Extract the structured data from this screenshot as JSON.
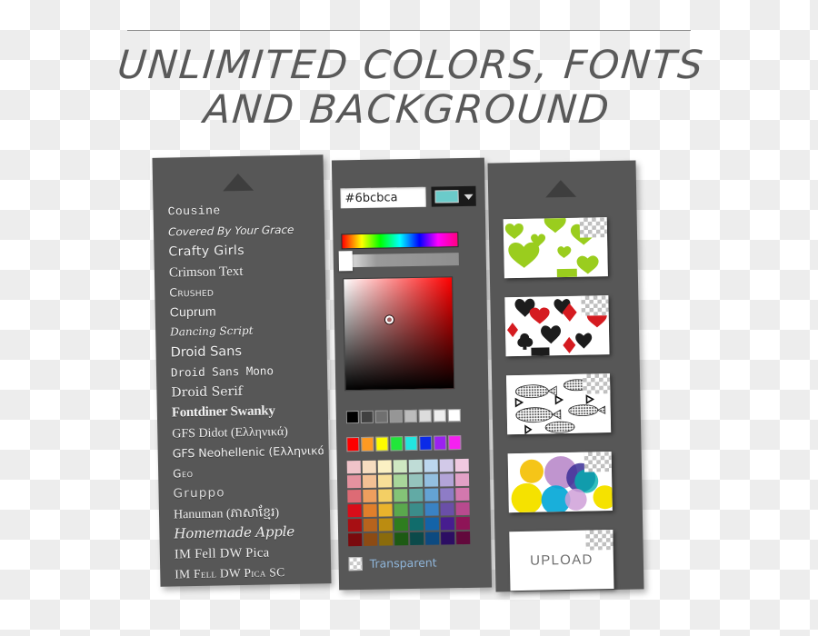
{
  "headline": {
    "line1": "UNLIMITED COLORS, FONTS",
    "line2": "AND BACKGROUND"
  },
  "fonts_panel": {
    "scroll_up_icon": "triangle-up-icon",
    "items": [
      {
        "label": "Cousine",
        "style": "f-mono"
      },
      {
        "label": "Covered By Your Grace",
        "style": "f-hand"
      },
      {
        "label": "Crafty Girls",
        "style": "f-round"
      },
      {
        "label": "Crimson Text",
        "style": "f-serif"
      },
      {
        "label": "Crushed",
        "style": "f-smallcap"
      },
      {
        "label": "Cuprum",
        "style": "f-cond"
      },
      {
        "label": "Dancing Script",
        "style": "f-script"
      },
      {
        "label": "Droid Sans",
        "style": "f-sans"
      },
      {
        "label": "Droid Sans Mono",
        "style": "f-sansmono"
      },
      {
        "label": "Droid Serif",
        "style": "f-dserif"
      },
      {
        "label": "Fontdiner Swanky",
        "style": "f-swanky"
      },
      {
        "label": "GFS Didot (Ελληνικά)",
        "style": "f-didot"
      },
      {
        "label": "GFS Neohellenic (Ελληνικά)",
        "style": "f-neo"
      },
      {
        "label": "Geo",
        "style": "f-geo"
      },
      {
        "label": "Gruppo",
        "style": "f-gruppo"
      },
      {
        "label": "Hanuman (ភាសាខ្មែរ)",
        "style": "f-hanu"
      },
      {
        "label": "Homemade Apple",
        "style": "f-apple"
      },
      {
        "label": "IM Fell DW Pica",
        "style": "f-pica"
      },
      {
        "label": "IM Fell DW Pica SC",
        "style": "f-picasc"
      }
    ]
  },
  "color_panel": {
    "hex_value": "#6bcbca",
    "hex_placeholder": "#ffffff",
    "current_swatch": "#6bcbca",
    "dropdown_icon": "chevron-down-icon",
    "transparent_label": "Transparent",
    "transparent_checked": false,
    "gray_swatches": [
      "#000000",
      "#404040",
      "#707070",
      "#969696",
      "#bcbcbc",
      "#dcdcdc",
      "#eeeeee",
      "#ffffff"
    ],
    "bright_swatches": [
      "#fe0000",
      "#ff9a22",
      "#fdfc00",
      "#21e63a",
      "#22e6e0",
      "#0b2ae8",
      "#9b22f0",
      "#f522f0"
    ],
    "palette": [
      "#f0c3c9",
      "#f6ddc0",
      "#fbf0c3",
      "#cfe8c2",
      "#bfdcd6",
      "#bcd6ee",
      "#d2c9e8",
      "#f0c9e0",
      "#e5929f",
      "#f3c094",
      "#f8df98",
      "#a8d69a",
      "#95c4bd",
      "#93bfe0",
      "#b3a4d8",
      "#e2a1c6",
      "#dd6b75",
      "#ee9f5e",
      "#f3cf64",
      "#84c377",
      "#62aaa5",
      "#64a3d4",
      "#8e7cc6",
      "#d378ae",
      "#d80d19",
      "#e07f2b",
      "#e9b32c",
      "#5aa84d",
      "#3b8d8a",
      "#3a82c4",
      "#6a4fa8",
      "#b84a8e",
      "#a70f13",
      "#b7631d",
      "#bb8c11",
      "#2e7d1e",
      "#106c6b",
      "#1463a8",
      "#471d8f",
      "#8e1457",
      "#7a0a0d",
      "#8c4b14",
      "#8a6b0c",
      "#1d5a14",
      "#0c4a4a",
      "#0d4a80",
      "#2c0e63",
      "#62093c"
    ],
    "sv_gradient_hue": "#ff0000"
  },
  "backgrounds_panel": {
    "scroll_up_icon": "triangle-up-icon",
    "thumbnails": [
      {
        "name": "green-hearts-pattern",
        "label": ""
      },
      {
        "name": "card-suits-pattern",
        "label": ""
      },
      {
        "name": "fish-pattern",
        "label": ""
      },
      {
        "name": "circles-pattern",
        "label": ""
      },
      {
        "name": "upload-tile",
        "label": "UPLOAD"
      }
    ]
  }
}
